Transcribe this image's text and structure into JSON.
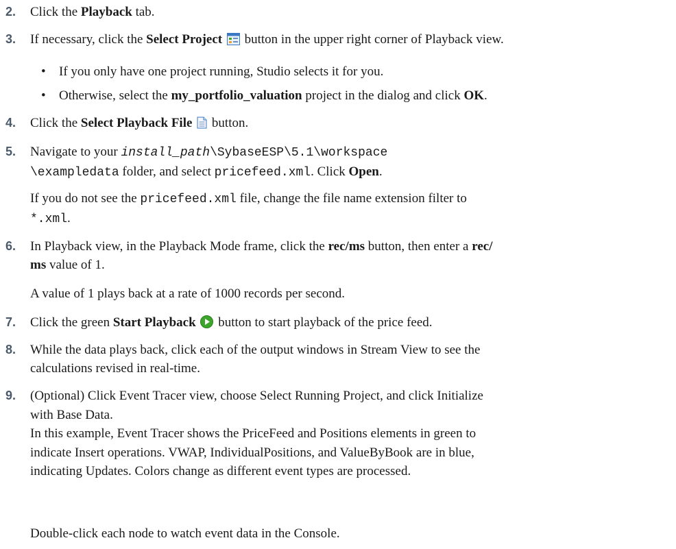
{
  "steps": {
    "s2": {
      "num": "2.",
      "t1": "Click the ",
      "b1": "Playback",
      "t2": " tab."
    },
    "s3": {
      "num": "3.",
      "t1": "If necessary, click the ",
      "b1": "Select Project",
      "t2": " button in the upper right corner of Playback view.",
      "icon": "select-project-icon"
    },
    "s4": {
      "num": "4.",
      "t1": "Click the ",
      "b1": "Select Playback File",
      "t2": " button.",
      "icon": "file-icon"
    },
    "s5": {
      "num": "5.",
      "t1": "Navigate to your ",
      "m_italic": "install_path",
      "m1": "\\SybaseESP\\5.1\\workspace",
      "m2": "\\exampledata",
      "t2": " folder, and select ",
      "m3": "pricefeed.xml",
      "t3": ". Click ",
      "b1": "Open",
      "t4": "."
    },
    "s6": {
      "num": "6.",
      "t1": "In Playback view, in the Playback Mode frame, click the ",
      "b1": "rec/ms",
      "t2": " button, then enter a ",
      "b2": "rec/",
      "b3": "ms",
      "t3": " value of 1."
    },
    "s7": {
      "num": "7.",
      "t1": "Click the green ",
      "b1": "Start Playback",
      "t2": " button to start playback of the price feed.",
      "icon": "start-playback-icon"
    },
    "s8": {
      "num": "8.",
      "l1": "While the data plays back, click each of the output windows in Stream View to see the",
      "l2": "calculations revised in real-time."
    },
    "s9": {
      "num": "9.",
      "l1": "(Optional) Click Event Tracer view, choose Select Running Project, and click Initialize",
      "l2": "with Base Data.",
      "l3": "In this example, Event Tracer shows the PriceFeed and Positions elements in green to",
      "l4": "indicate Insert operations. VWAP, IndividualPositions, and ValueByBook are in blue,",
      "l5": "indicating Updates. Colors change as different event types are processed."
    }
  },
  "bullets": {
    "b1": {
      "symbol": "•",
      "text": "If you only have one project running, Studio selects it for you."
    },
    "b2": {
      "symbol": "•",
      "t1": "Otherwise, select the ",
      "b1": "my_portfolio_valuation",
      "t2": " project in the dialog and click ",
      "b2": "OK",
      "t3": "."
    }
  },
  "paras": {
    "p5a": {
      "t1": "If you do not see the ",
      "m1": "pricefeed.xml",
      "t2": " file, change the file name extension filter to"
    },
    "p5b": {
      "m1": "*.xml",
      "t1": "."
    },
    "p6": "A value of 1 plays back at a rate of 1000 records per second.",
    "p9": "Double-click each node to watch event data in the Console."
  },
  "colors": {
    "step_number": "#4a5a6a",
    "playback_green": "#3ea52c",
    "icon_blue": "#3b78c4"
  }
}
